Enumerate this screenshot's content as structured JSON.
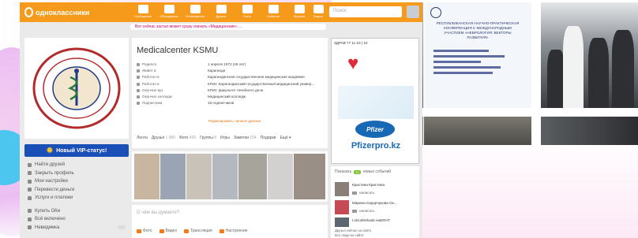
{
  "site": {
    "logo_text": "одноклассники"
  },
  "nav": [
    {
      "label": "Сообщения",
      "badge": ""
    },
    {
      "label": "Обсуждения",
      "badge": ""
    },
    {
      "label": "Оповещения",
      "badge": ""
    },
    {
      "label": "Друзья",
      "badge": ""
    },
    {
      "label": "Гости",
      "badge": ""
    },
    {
      "label": "События",
      "badge": ""
    },
    {
      "label": "Музыка",
      "badge": ""
    },
    {
      "label": "Видео",
      "badge": ""
    }
  ],
  "search": {
    "placeholder": "Поиск"
  },
  "notice": "Вот сейчас застал может сразу скачать «Медицинские» …",
  "vip": {
    "label": "Новый VIP-статус!"
  },
  "menu": [
    {
      "label": "Найти друзей"
    },
    {
      "label": "Закрыть профиль"
    },
    {
      "label": "Мои настройки"
    },
    {
      "label": "Перевести деньги"
    },
    {
      "label": "Услуги и платежи"
    }
  ],
  "menu2": [
    {
      "label": "Купить ОКи"
    },
    {
      "label": "Всё включено"
    },
    {
      "label": "Невидимка"
    }
  ],
  "profile": {
    "name": "Medicalcenter KSMU",
    "info": [
      {
        "key": "Родился",
        "value": "1 апреля 1972 (45 лет)"
      },
      {
        "key": "Живет в",
        "value": "Караганда"
      },
      {
        "key": "Работал в",
        "value": "Карагандинская государственная медицинская академия"
      },
      {
        "key": "Работал в",
        "value": "КГМУ, Карагандинский государственный медицинский универ..."
      },
      {
        "key": "Окончил вуз",
        "value": "КГМУ, факультет лечебного дела"
      },
      {
        "key": "Окончил колледж",
        "value": "Медицинский колледж"
      },
      {
        "key": "Подписчики",
        "value": "15 подписчиков"
      }
    ],
    "edit_link": "Редактировать личные данные",
    "tabs": [
      {
        "label": "Лента",
        "count": ""
      },
      {
        "label": "Друзья",
        "count": "1 980"
      },
      {
        "label": "Фото",
        "count": "400"
      },
      {
        "label": "Группы",
        "count": "8"
      },
      {
        "label": "Игры",
        "count": ""
      },
      {
        "label": "Заметки",
        "count": "104"
      },
      {
        "label": "Подарки",
        "count": ""
      },
      {
        "label": "Ещё ▾",
        "count": ""
      }
    ]
  },
  "post": {
    "placeholder": "О чём вы думаете?",
    "buttons": [
      "Фото",
      "Видео",
      "Трансляция",
      "Настроение"
    ]
  },
  "ad": {
    "header": "ЗДРАВ 77 11 10 | 10",
    "brand": "Pfizer",
    "url": "Pfizerpro.kz"
  },
  "events": {
    "header": "Показать",
    "badge": "20",
    "header_tail": "новых событий",
    "friends": [
      {
        "name": "Кристина Кристина",
        "action": "написать"
      },
      {
        "name": "Марина Сидорчукова Ок...",
        "action": "написать"
      },
      {
        "name": "t.old.dirtshaob ewERAT",
        "action": ""
      }
    ],
    "footer": [
      "Друзья сейчас на сайте",
      "Все люди на сайте"
    ]
  },
  "tiles": {
    "conference_text": "РЕСПУБЛИКАНСКАЯ НАУЧНО-ПРАКТИЧЕСКАЯ КОНФЕРЕНЦИЯ С МЕЖДУНАРОДНЫМ УЧАСТИЕМ «НЕВРОЛОГИЯ: ВЕКТОРЫ РАЗВИТИЯ»"
  }
}
